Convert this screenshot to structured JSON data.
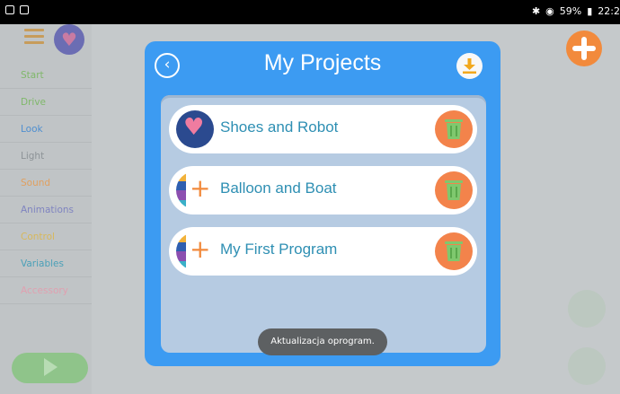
{
  "status_bar": {
    "battery": "59%",
    "time": "22:2",
    "icons": [
      "notification-icon",
      "image-icon",
      "bluetooth-icon",
      "wifi-icon",
      "battery-icon"
    ]
  },
  "background": {
    "categories": [
      "Start",
      "Drive",
      "Look",
      "Light",
      "Sound",
      "Animations",
      "Control",
      "Variables",
      "Accessory"
    ],
    "category_colors": [
      "#7fb86a",
      "#7fb86a",
      "#4f8fd0",
      "#9aa0a4",
      "#e0a060",
      "#7f84c0",
      "#d8b85a",
      "#4aa0b8",
      "#e0a0b0"
    ],
    "icons": [
      "menu-icon",
      "heart-icon",
      "play-icon",
      "plus-icon"
    ]
  },
  "modal": {
    "title": "My Projects",
    "back_icon": "chevron-left-icon",
    "download_icon": "download-icon",
    "projects": [
      {
        "name": "Shoes and Robot",
        "thumb": "heart-icon"
      },
      {
        "name": "Balloon and Boat",
        "thumb": "new-project-icon"
      },
      {
        "name": "My First Program",
        "thumb": "new-project-icon"
      }
    ],
    "delete_icon": "trash-icon"
  },
  "toast": "Aktualizacja oprogram.",
  "colors": {
    "modal_blue": "#3c9bf2",
    "accent_orange": "#f28a3c",
    "trash_orange": "#f3834b",
    "project_text": "#2e8fb3"
  }
}
